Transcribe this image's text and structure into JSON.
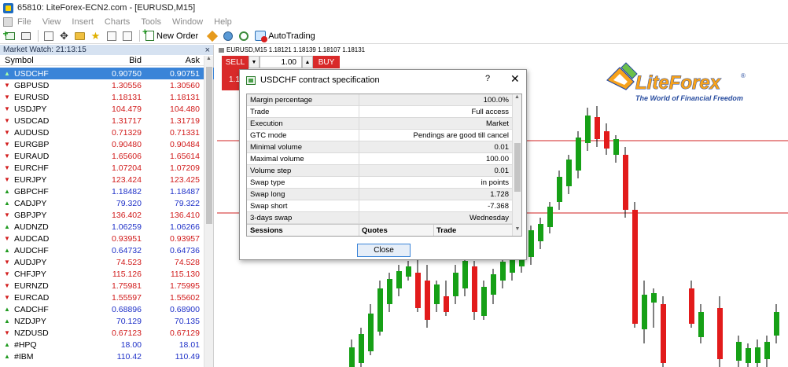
{
  "window": {
    "title": "65810: LiteForex-ECN2.com - [EURUSD,M15]"
  },
  "menu": [
    "File",
    "View",
    "Insert",
    "Charts",
    "Tools",
    "Window",
    "Help"
  ],
  "toolbar": {
    "new_order": "New Order",
    "autotrading": "AutoTrading"
  },
  "market_watch": {
    "header": "Market Watch: 21:13:15",
    "close_glyph": "×",
    "columns": {
      "symbol": "Symbol",
      "bid": "Bid",
      "ask": "Ask"
    },
    "rows": [
      {
        "symbol": "USDCHF",
        "bid": "0.90750",
        "ask": "0.90751",
        "dir": "up",
        "color": "selected"
      },
      {
        "symbol": "GBPUSD",
        "bid": "1.30556",
        "ask": "1.30560",
        "dir": "down",
        "color": "red"
      },
      {
        "symbol": "EURUSD",
        "bid": "1.18131",
        "ask": "1.18131",
        "dir": "down",
        "color": "red"
      },
      {
        "symbol": "USDJPY",
        "bid": "104.479",
        "ask": "104.480",
        "dir": "down",
        "color": "red"
      },
      {
        "symbol": "USDCAD",
        "bid": "1.31717",
        "ask": "1.31719",
        "dir": "down",
        "color": "red"
      },
      {
        "symbol": "AUDUSD",
        "bid": "0.71329",
        "ask": "0.71331",
        "dir": "down",
        "color": "red"
      },
      {
        "symbol": "EURGBP",
        "bid": "0.90480",
        "ask": "0.90484",
        "dir": "down",
        "color": "red"
      },
      {
        "symbol": "EURAUD",
        "bid": "1.65606",
        "ask": "1.65614",
        "dir": "down",
        "color": "red"
      },
      {
        "symbol": "EURCHF",
        "bid": "1.07204",
        "ask": "1.07209",
        "dir": "down",
        "color": "red"
      },
      {
        "symbol": "EURJPY",
        "bid": "123.424",
        "ask": "123.425",
        "dir": "down",
        "color": "red"
      },
      {
        "symbol": "GBPCHF",
        "bid": "1.18482",
        "ask": "1.18487",
        "dir": "up",
        "color": "blue"
      },
      {
        "symbol": "CADJPY",
        "bid": "79.320",
        "ask": "79.322",
        "dir": "up",
        "color": "blue"
      },
      {
        "symbol": "GBPJPY",
        "bid": "136.402",
        "ask": "136.410",
        "dir": "down",
        "color": "red"
      },
      {
        "symbol": "AUDNZD",
        "bid": "1.06259",
        "ask": "1.06266",
        "dir": "up",
        "color": "blue"
      },
      {
        "symbol": "AUDCAD",
        "bid": "0.93951",
        "ask": "0.93957",
        "dir": "down",
        "color": "red"
      },
      {
        "symbol": "AUDCHF",
        "bid": "0.64732",
        "ask": "0.64736",
        "dir": "up",
        "color": "blue"
      },
      {
        "symbol": "AUDJPY",
        "bid": "74.523",
        "ask": "74.528",
        "dir": "down",
        "color": "red"
      },
      {
        "symbol": "CHFJPY",
        "bid": "115.126",
        "ask": "115.130",
        "dir": "down",
        "color": "red"
      },
      {
        "symbol": "EURNZD",
        "bid": "1.75981",
        "ask": "1.75995",
        "dir": "down",
        "color": "red"
      },
      {
        "symbol": "EURCAD",
        "bid": "1.55597",
        "ask": "1.55602",
        "dir": "down",
        "color": "red"
      },
      {
        "symbol": "CADCHF",
        "bid": "0.68896",
        "ask": "0.68900",
        "dir": "up",
        "color": "blue"
      },
      {
        "symbol": "NZDJPY",
        "bid": "70.129",
        "ask": "70.135",
        "dir": "up",
        "color": "blue"
      },
      {
        "symbol": "NZDUSD",
        "bid": "0.67123",
        "ask": "0.67129",
        "dir": "down",
        "color": "red"
      },
      {
        "symbol": "#HPQ",
        "bid": "18.00",
        "ask": "18.01",
        "dir": "up",
        "color": "blue"
      },
      {
        "symbol": "#IBM",
        "bid": "110.42",
        "ask": "110.49",
        "dir": "up",
        "color": "blue"
      }
    ]
  },
  "chart": {
    "header": "EURUSD,M15  1.18121 1.18139 1.18107 1.18131",
    "sell": "SELL",
    "buy": "BUY",
    "volume": "1.00",
    "sell_price_partial": "1.1",
    "colors": {
      "bull": "#16a016",
      "bear": "#e21b1b",
      "level": "#d02020"
    }
  },
  "logo": {
    "brand": "LiteForex",
    "reg": "®",
    "slogan": "The World of Financial Freedom"
  },
  "dialog": {
    "title": "USDCHF contract specification",
    "help": "?",
    "close_glyph": "✕",
    "rows": [
      {
        "k": "Margin percentage",
        "v": "100.0%"
      },
      {
        "k": "Trade",
        "v": "Full access"
      },
      {
        "k": "Execution",
        "v": "Market"
      },
      {
        "k": "GTC mode",
        "v": "Pendings are good till cancel"
      },
      {
        "k": "Minimal volume",
        "v": "0.01"
      },
      {
        "k": "Maximal volume",
        "v": "100.00"
      },
      {
        "k": "Volume step",
        "v": "0.01"
      },
      {
        "k": "Swap type",
        "v": "in points"
      },
      {
        "k": "Swap long",
        "v": "1.728"
      },
      {
        "k": "Swap short",
        "v": "-7.368"
      },
      {
        "k": "3-days swap",
        "v": "Wednesday"
      }
    ],
    "footer": {
      "sessions": "Sessions",
      "quotes": "Quotes",
      "trade": "Trade"
    },
    "close_button": "Close"
  }
}
